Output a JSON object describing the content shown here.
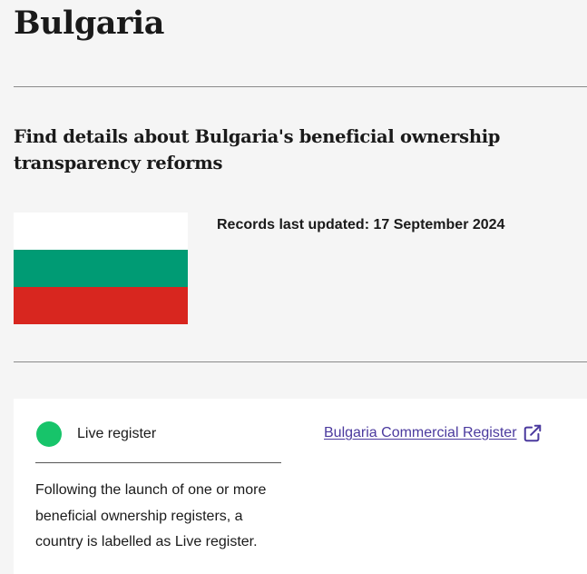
{
  "page": {
    "title": "Bulgaria",
    "subtitle": "Find details about Bulgaria's beneficial ownership transparency reforms",
    "records_updated": "Records last updated: 17 September 2024"
  },
  "flag": {
    "colors": [
      "#ffffff",
      "#009b74",
      "#d8261f"
    ],
    "icon": "bulgaria-flag"
  },
  "status_card": {
    "status_label": "Live register",
    "status_color": "#17c46a",
    "description": "Following the launch of one or more beneficial ownership registers, a country is labelled as Live register.",
    "register_link": {
      "label": "Bulgaria Commercial Register",
      "icon": "external-link-icon",
      "color": "#4b3a9e"
    }
  }
}
